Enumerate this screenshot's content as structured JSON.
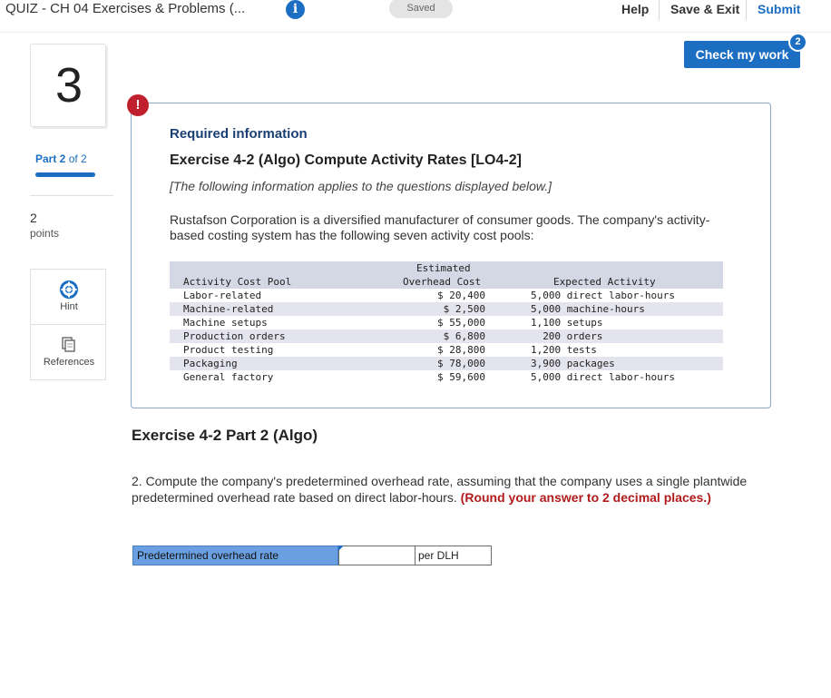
{
  "header": {
    "quiz_title": "QUIZ - CH 04 Exercises & Problems (...",
    "saved_label": "Saved",
    "help_label": "Help",
    "save_exit_label": "Save & Exit",
    "submit_label": "Submit",
    "check_work_label": "Check my work",
    "check_work_badge": "2"
  },
  "rail": {
    "question_number": "3",
    "part_current": "Part 2",
    "part_total": " of 2",
    "points_value": "2",
    "points_label": "points",
    "hint_label": "Hint",
    "references_label": "References"
  },
  "info": {
    "alert_symbol": "!",
    "required_label": "Required information",
    "exercise_title": "Exercise 4-2 (Algo) Compute Activity Rates [LO4-2]",
    "subtitle": "[The following information applies to the questions displayed below.]",
    "body": "Rustafson Corporation is a diversified manufacturer of consumer goods. The company's activity-based costing system has the following seven activity cost pools:",
    "table": {
      "header_top": "Estimated",
      "col1": "Activity Cost Pool",
      "col2": "Overhead Cost",
      "col3": "Expected Activity",
      "rows": [
        [
          "Labor-related",
          "$ 20,400",
          "5,000 direct labor-hours"
        ],
        [
          "Machine-related",
          "$ 2,500",
          "5,000 machine-hours"
        ],
        [
          "Machine setups",
          "$ 55,000",
          "1,100 setups"
        ],
        [
          "Production orders",
          "$ 6,800",
          "200 orders"
        ],
        [
          "Product testing",
          "$ 28,800",
          "1,200 tests"
        ],
        [
          "Packaging",
          "$ 78,000",
          "3,900 packages"
        ],
        [
          "General factory",
          "$ 59,600",
          "5,000 direct labor-hours"
        ]
      ]
    }
  },
  "part2": {
    "title": "Exercise 4-2 Part 2 (Algo)",
    "question_text": "2. Compute the company's predetermined overhead rate, assuming that the company uses a single plantwide predetermined overhead rate based on direct labor-hours. ",
    "question_note": "(Round your answer to 2 decimal places.)",
    "answer_label": "Predetermined overhead rate",
    "answer_value": "",
    "answer_unit": "per DLH"
  },
  "colors": {
    "accent": "#1b6ec2",
    "alert": "#c0202e",
    "answer_label_bg": "#6aa0e2"
  }
}
